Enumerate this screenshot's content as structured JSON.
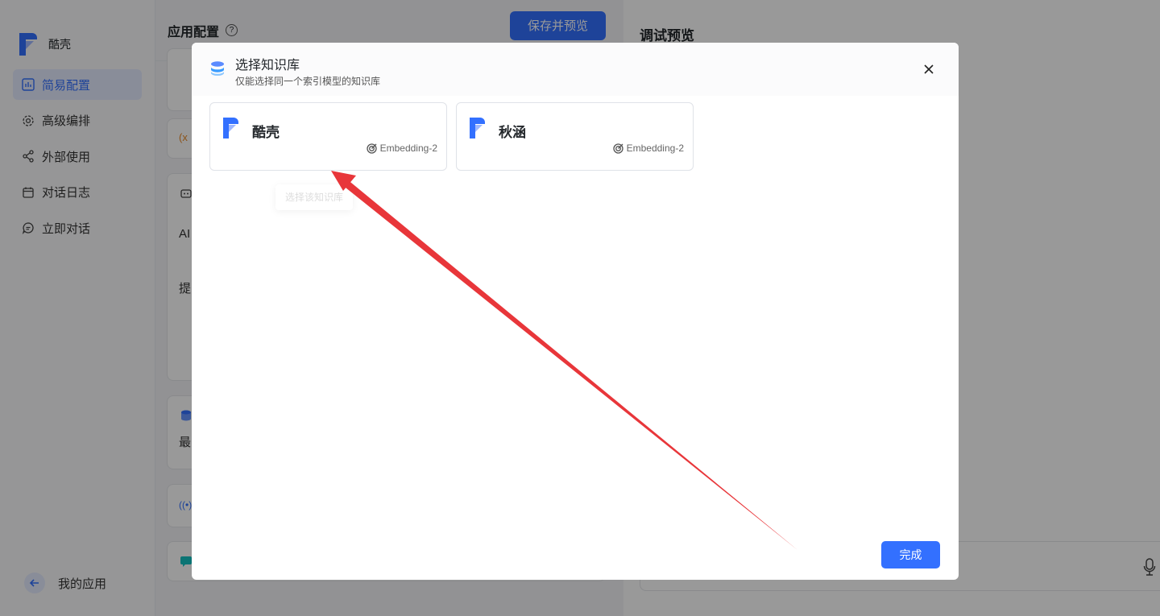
{
  "app": {
    "brand_name": "酷壳"
  },
  "sidebar": {
    "items": [
      {
        "label": "简易配置",
        "active": true
      },
      {
        "label": "高级编排"
      },
      {
        "label": "外部使用"
      },
      {
        "label": "对话日志"
      },
      {
        "label": "立即对话"
      }
    ],
    "back_label": "我的应用"
  },
  "config": {
    "title": "应用配置",
    "save_label": "保存并预览",
    "snippets": [
      "(x",
      "AI",
      "提",
      "最"
    ]
  },
  "preview": {
    "title": "调试预览"
  },
  "modal": {
    "title": "选择知识库",
    "subtitle": "仅能选择同一个索引模型的知识库",
    "tooltip": "选择该知识库",
    "done_label": "完成",
    "datasets": [
      {
        "name": "酷壳",
        "model": "Embedding-2"
      },
      {
        "name": "秋涵",
        "model": "Embedding-2"
      }
    ]
  },
  "colors": {
    "accent": "#3370ff",
    "arrow": "#e8363a"
  }
}
